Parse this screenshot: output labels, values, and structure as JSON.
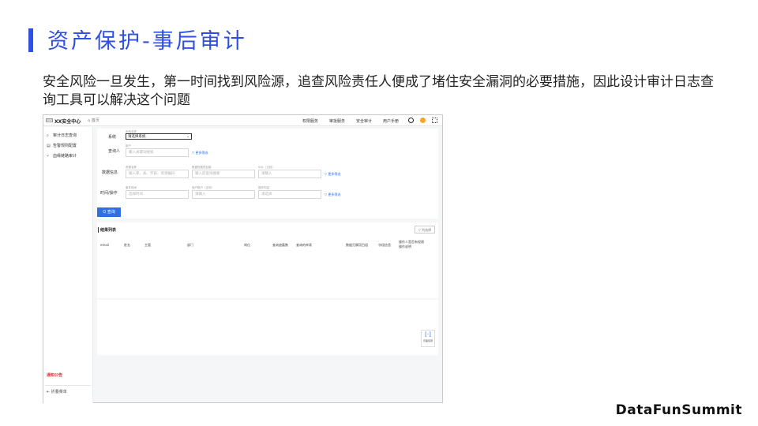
{
  "slide": {
    "title": "资产保护-事后审计",
    "body": "安全风险一旦发生，第一时间找到风险源，追查风险责任人便成了堵住安全漏洞的必要措施，因此设计审计日志查询工具可以解决这个问题",
    "brand": "DataFunSummit"
  },
  "app": {
    "logo": "LOGO",
    "title": "XX安全中心",
    "home_label": "首页",
    "top_nav": [
      "权限服务",
      "审批服务",
      "安全审计",
      "用户手册"
    ],
    "icons": [
      "refresh-icon",
      "user-avatar-icon",
      "grid-icon"
    ],
    "sidebar": [
      {
        "icon": "search-icon",
        "glyph": "⌕",
        "label": "审计日志查询"
      },
      {
        "icon": "rules-icon",
        "glyph": "▤",
        "label": "告警规则配置"
      },
      {
        "icon": "branch-icon",
        "glyph": "⑂",
        "label": "血缘链路审计"
      }
    ],
    "notice": "通知公告",
    "collapse": "⇤ 折叠菜单",
    "form": {
      "system_label": "系统",
      "system_small": "系统名称",
      "system_value": "请选择系统",
      "querier_label": "查询人",
      "user_small": "用户",
      "user_placeholder": "输入关键词搜索",
      "more_filter": "更多筛选",
      "data_label": "数据信息",
      "resource_small": "资源名称",
      "resource_placeholder": "输入库、表、字段、资源编码",
      "target_small": "数据所属项目组",
      "target_placeholder": "输入后查询搜索",
      "sql_small": "SQL（正则）",
      "sql_placeholder": "请输入",
      "time_label": "时间/操作",
      "event_small": "事件时间",
      "event_placeholder": "选择时间",
      "user_ip_small": "用户账户（正则）",
      "user_ip_placeholder": "请输入",
      "action_small": "操作内容",
      "action_placeholder": "请选择",
      "query_button": "Q 查询"
    },
    "results": {
      "title": "结果列表",
      "column_btn": "▽ 列选择",
      "columns": [
        "email",
        "姓名",
        "主管",
        "部门",
        "岗位",
        "查询遮蔽数",
        "查询的库表",
        "数据归属项目组",
        "字段信息",
        "操作人是否有权限",
        "操作说明"
      ]
    },
    "fab": {
      "glyph": "[·]",
      "label": "页面截屏"
    }
  }
}
